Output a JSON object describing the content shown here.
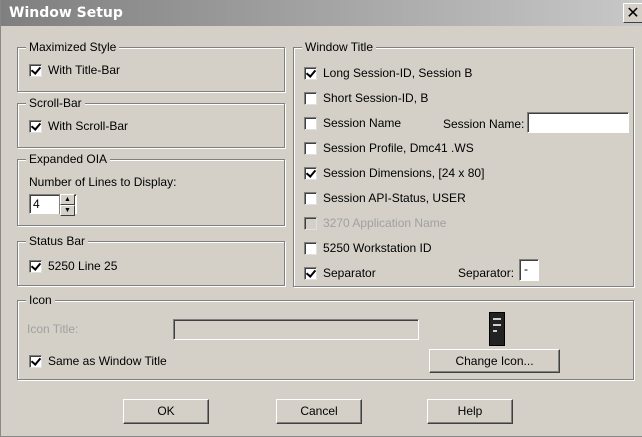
{
  "window": {
    "title": "Window Setup",
    "close_glyph": "✕"
  },
  "maximized_style": {
    "label": "Maximized Style",
    "with_title_bar": {
      "label": "With Title-Bar",
      "checked": true
    }
  },
  "scroll_bar": {
    "label": "Scroll-Bar",
    "with_scroll_bar": {
      "label": "With Scroll-Bar",
      "checked": true
    }
  },
  "expanded_oia": {
    "label": "Expanded OIA",
    "lines_label": "Number of Lines to Display:",
    "lines_value": "4"
  },
  "status_bar": {
    "label": "Status Bar",
    "line25": {
      "label": "5250 Line 25",
      "checked": true
    }
  },
  "window_title": {
    "label": "Window Title",
    "long_session_id": {
      "label": "Long Session-ID,  Session B",
      "checked": true
    },
    "short_session_id": {
      "label": "Short Session-ID,  B",
      "checked": false
    },
    "session_name": {
      "label": "Session Name",
      "checked": false,
      "field_label": "Session Name:",
      "value": ""
    },
    "session_profile": {
      "label": "Session Profile,  Dmc41 .WS",
      "checked": false
    },
    "session_dimensions": {
      "label": "Session Dimensions,  [24 x 80]",
      "checked": true
    },
    "session_api_status": {
      "label": "Session API-Status,  USER",
      "checked": false
    },
    "app_name_3270": {
      "label": "3270 Application Name",
      "checked": false,
      "disabled": true
    },
    "workstation_id": {
      "label": "5250 Workstation ID",
      "checked": false
    },
    "separator": {
      "label": "Separator",
      "checked": true,
      "field_label": "Separator:",
      "value": "-"
    }
  },
  "icon": {
    "label": "Icon",
    "icon_title_label": "Icon Title:",
    "icon_title_value": "",
    "same_as_window_title": {
      "label": "Same as Window Title",
      "checked": true
    },
    "change_icon_label": "Change Icon...",
    "preview_icon": "mainframe-terminal-icon"
  },
  "buttons": {
    "ok": "OK",
    "cancel": "Cancel",
    "help": "Help"
  }
}
